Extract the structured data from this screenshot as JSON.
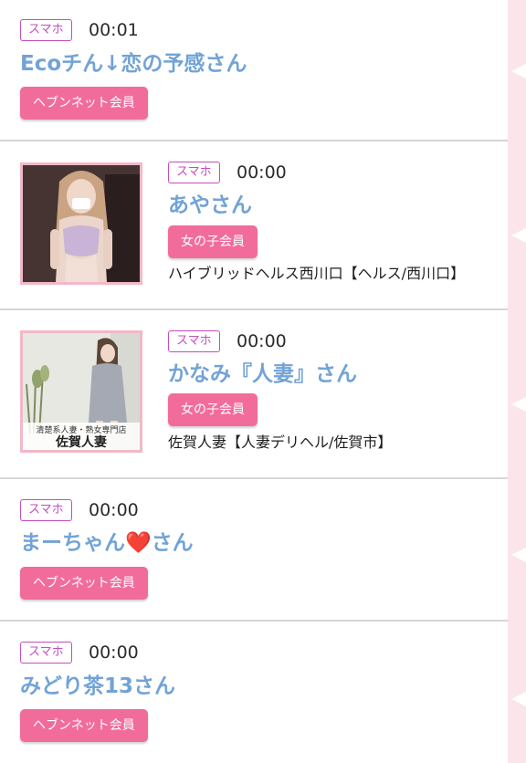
{
  "entries": [
    {
      "badge": "スマホ",
      "time": "00:01",
      "name": "Ecoチん↓恋の予感さん",
      "member": "ヘブンネット会員"
    },
    {
      "badge": "スマホ",
      "time": "00:00",
      "name": "あやさん",
      "member": "女の子会員",
      "shop": "ハイブリッドヘルス西川口【ヘルス/西川口】"
    },
    {
      "badge": "スマホ",
      "time": "00:00",
      "name": "かなみ『人妻』さん",
      "member": "女の子会員",
      "shop": "佐賀人妻【人妻デリヘル/佐賀市】",
      "photo_caption": "清楚系人妻・熟女専門店",
      "photo_logo": "佐賀人妻"
    },
    {
      "badge": "スマホ",
      "time": "00:00",
      "name_prefix": "まーちゃん",
      "name_emoji": "❤️",
      "name_suffix": "さん",
      "member": "ヘブンネット会員"
    },
    {
      "badge": "スマホ",
      "time": "00:00",
      "name": "みどり茶13さん",
      "member": "ヘブンネット会員"
    }
  ],
  "colors": {
    "name_text": "#72a3d6",
    "badge_border": "#c54dbd",
    "member_button": "#f26c9b",
    "right_rail": "#fbe5ea",
    "thumb_border": "#f2b8c8"
  }
}
